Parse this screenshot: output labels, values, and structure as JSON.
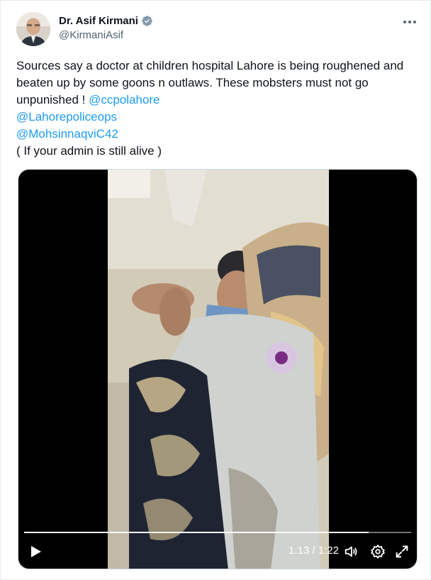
{
  "author": {
    "name": "Dr. Asif Kirmani",
    "handle": "@KirmaniAsif",
    "verified": true
  },
  "menu": {
    "icon": "more-horizontal-icon"
  },
  "tweet": {
    "line1": "Sources say a doctor at children hospital Lahore is being roughened and",
    "line2": "beaten up by some goons n outlaws.  These mobsters must not go",
    "line3_text": "unpunished ! ",
    "mention1": "@ccpolahore",
    "mention2": "@Lahorepoliceops",
    "mention3": "@MohsinnaqviC42",
    "line_last": "( If your admin is still alive )"
  },
  "video": {
    "current_time": "1:13",
    "separator": " / ",
    "duration": "1:22",
    "progress_fraction": 0.89,
    "icons": [
      "play-icon",
      "volume-icon",
      "settings-icon",
      "fullscreen-icon"
    ]
  },
  "colors": {
    "link": "#1d9bf0",
    "verified": "#829aab",
    "text": "#0f1419",
    "muted": "#536471"
  }
}
